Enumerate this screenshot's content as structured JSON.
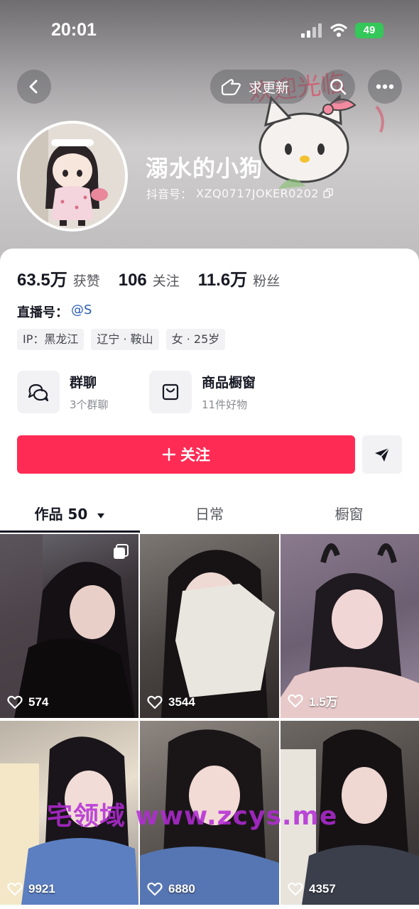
{
  "status_bar": {
    "time": "20:01",
    "battery": "49"
  },
  "header": {
    "back_icon": "chevron-left-icon",
    "request_update_label": "求更新",
    "search_icon": "search-icon",
    "more_icon": "more-dots-icon",
    "decoration_text": "欢迎光临"
  },
  "profile": {
    "nickname": "溺水的小狗",
    "douyin_id_label": "抖音号：",
    "douyin_id": "XZQ0717JOKER0202",
    "copy_icon": "copy-icon"
  },
  "stats": [
    {
      "value": "63.5万",
      "label": "获赞"
    },
    {
      "value": "106",
      "label": "关注"
    },
    {
      "value": "11.6万",
      "label": "粉丝"
    }
  ],
  "live": {
    "label": "直播号：",
    "value": "@S"
  },
  "tags": [
    "IP：黑龙江",
    "辽宁 · 鞍山",
    "女 · 25岁"
  ],
  "features": [
    {
      "title": "群聊",
      "subtitle": "3个群聊",
      "icon": "chat-bubbles-icon"
    },
    {
      "title": "商品橱窗",
      "subtitle": "11件好物",
      "icon": "shopping-bag-icon"
    }
  ],
  "actions": {
    "follow_label": "关注",
    "follow_icon": "plus-icon",
    "share_icon": "send-icon"
  },
  "tabs": [
    {
      "label": "作品 50",
      "active": true
    },
    {
      "label": "日常",
      "active": false
    },
    {
      "label": "橱窗",
      "active": false
    }
  ],
  "videos": [
    {
      "likes": "574",
      "multi": true
    },
    {
      "likes": "3544",
      "multi": false
    },
    {
      "likes": "1.5万",
      "multi": false
    },
    {
      "likes": "9921",
      "multi": false
    },
    {
      "likes": "6880",
      "multi": false
    },
    {
      "likes": "4357",
      "multi": false
    }
  ],
  "watermark": "宅领域 www.zcys.me",
  "colors": {
    "accent": "#fe2c55",
    "link": "#2a5db0",
    "watermark": "#b32bd6"
  }
}
